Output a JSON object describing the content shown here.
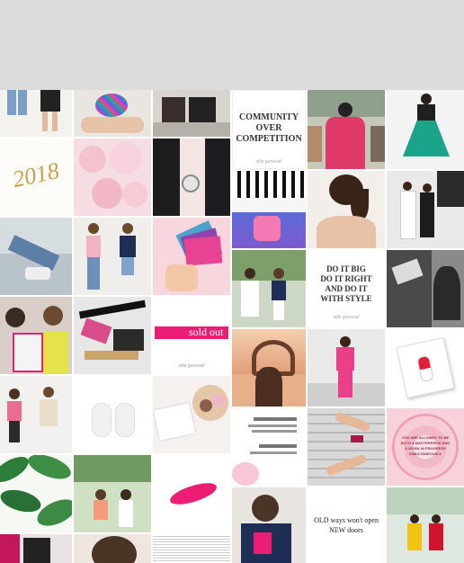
{
  "header": {
    "bg": "#dcdcdc"
  },
  "tiles": {
    "community": {
      "line1": "COMMUNITY",
      "line2": "OVER",
      "line3": "COMPETITION",
      "sig": "stile gunovali"
    },
    "year": {
      "text": "2018"
    },
    "soldout": {
      "text": "sold out",
      "sig": "stile gunovali"
    },
    "doitbig": {
      "line1": "DO IT BIG",
      "line2": "DO IT RIGHT",
      "line3": "AND DO IT",
      "line4": "WITH STYLE",
      "sig": "stile gunovali"
    },
    "oldways": {
      "line1": "OLD ways won't open",
      "line2": "NEW doors"
    },
    "rose": {
      "text": "YOU ARE ALLOWED TO BE BOTH A MASTERPIECE AND A WORK IN PROGRESS SIMULTANEOUSLY"
    }
  },
  "colors": {
    "accent": "#ec1d73",
    "gold": "#c8a24b"
  }
}
